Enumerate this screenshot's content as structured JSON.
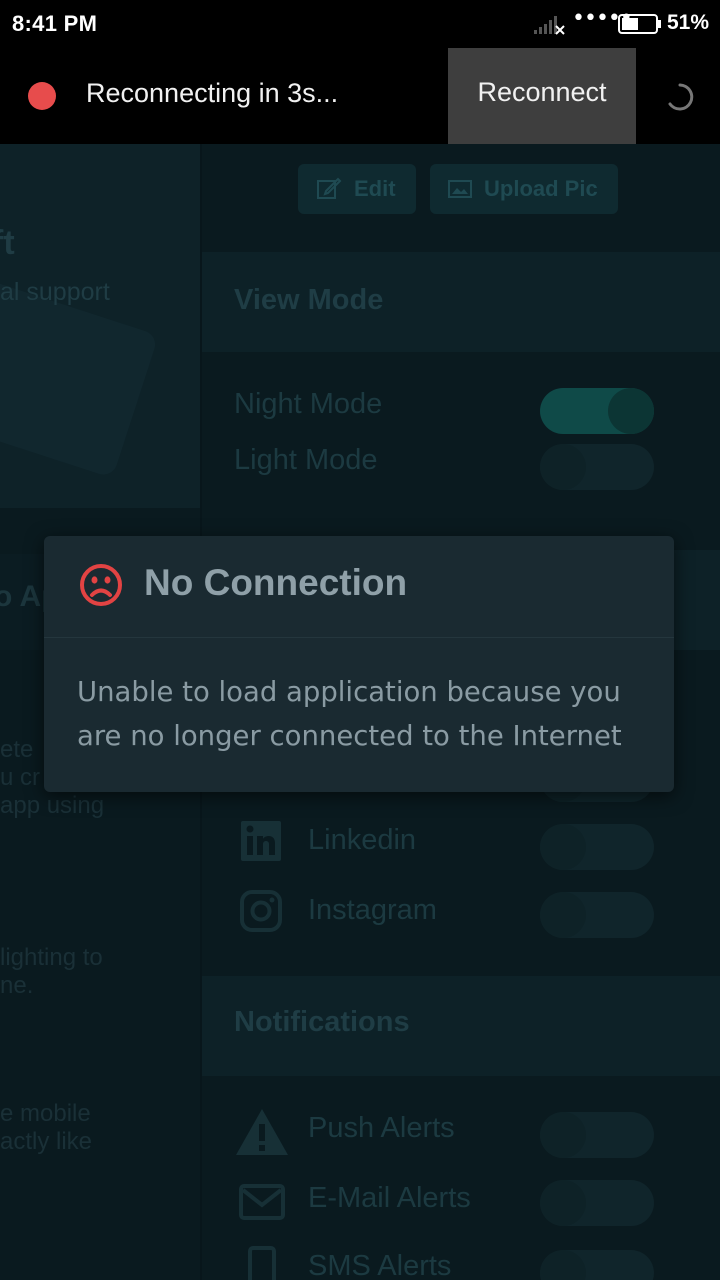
{
  "status_bar": {
    "time": "8:41 PM",
    "dots": "•••••",
    "battery_percent": "51%",
    "battery_level": 0.51
  },
  "banner": {
    "message": "Reconnecting in 3s...",
    "reconnect_label": "Reconnect",
    "dot_color": "#e74c4c"
  },
  "background_app": {
    "left": {
      "promo_title": "ft",
      "promo_subtitle": "al support",
      "section_title": "o Ap",
      "para1": [
        "ete",
        "u cr",
        "app using"
      ],
      "para2": [
        "lighting to",
        "ne."
      ],
      "para3": [
        "e mobile",
        "actly like"
      ]
    },
    "actions": {
      "edit_label": "Edit",
      "upload_label": "Upload Pic"
    },
    "view_mode": {
      "title": "View Mode",
      "night_label": "Night Mode",
      "night_on": true,
      "light_label": "Light Mode",
      "light_on": false
    },
    "social": {
      "linkedin_label": "Linkedin",
      "instagram_label": "Instagram"
    },
    "notifications": {
      "title": "Notifications",
      "push_label": "Push Alerts",
      "email_label": "E-Mail Alerts",
      "sms_label": "SMS Alerts"
    }
  },
  "dialog": {
    "title": "No Connection",
    "body": "Unable to load application because you are no longer connected to the Internet",
    "icon": "sad-face-icon",
    "icon_color": "#e24343"
  }
}
